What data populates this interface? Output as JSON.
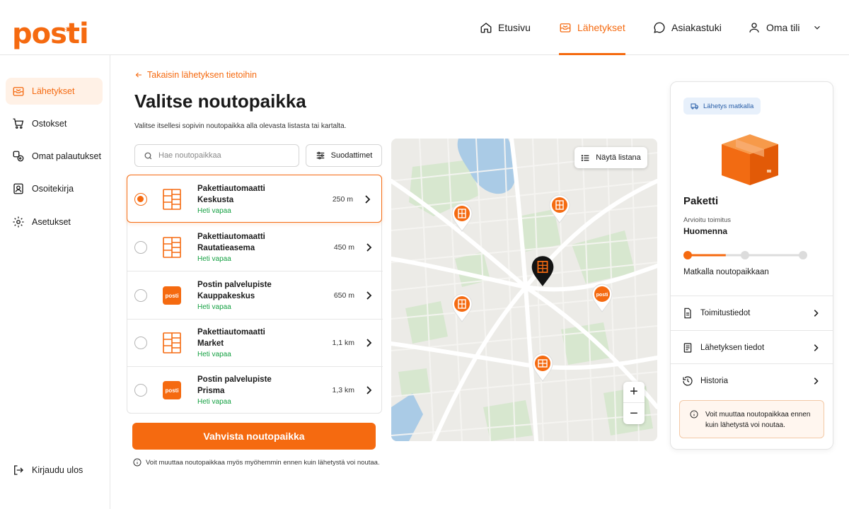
{
  "app": {
    "logo_text": "posti",
    "accent": "#f56a10"
  },
  "header": {
    "nav": [
      {
        "label": "Etusivu",
        "icon": "home-icon"
      },
      {
        "label": "Lähetykset",
        "icon": "package-inbox-icon",
        "active": true
      },
      {
        "label": "Asiakastuki",
        "icon": "chat-bubble-icon"
      },
      {
        "label": "Oma tili",
        "icon": "user-icon"
      }
    ]
  },
  "sidebar": {
    "items": [
      {
        "label": "Lähetykset",
        "icon": "package-inbox-icon",
        "active": true
      },
      {
        "label": "Ostokset",
        "icon": "cart-icon"
      },
      {
        "label": "Omat palautukset",
        "icon": "return-icon"
      },
      {
        "label": "Osoitekirja",
        "icon": "address-book-icon"
      },
      {
        "label": "Asetukset",
        "icon": "gear-icon"
      }
    ],
    "logout": "Kirjaudu ulos"
  },
  "main": {
    "back_link": "Takaisin lähetyksen tietoihin",
    "title": "Valitse noutopaikka",
    "description": "Valitse itsellesi sopivin noutopaikka alla olevasta listasta tai kartalta.",
    "search_placeholder": "Hae noutopaikkaa",
    "filters_label": "Suodattimet",
    "locations": [
      {
        "line1": "Pakettiautomaatti",
        "line2": "Keskusta",
        "status": "Heti vapaa",
        "distance": "250 m",
        "type": "locker",
        "selected": true
      },
      {
        "line1": "Pakettiautomaatti",
        "line2": "Rautatieasema",
        "status": "Heti vapaa",
        "distance": "450 m",
        "type": "locker",
        "selected": false
      },
      {
        "line1": "Postin palvelupiste",
        "line2": "Kauppakeskus",
        "status": "Heti vapaa",
        "distance": "650 m",
        "type": "posti",
        "selected": false
      },
      {
        "line1": "Pakettiautomaatti",
        "line2": "Market",
        "status": "Heti vapaa",
        "distance": "1,1 km",
        "type": "locker",
        "selected": false
      },
      {
        "line1": "Postin palvelupiste",
        "line2": "Prisma",
        "status": "Heti vapaa",
        "distance": "1,3 km",
        "type": "posti",
        "selected": false
      }
    ],
    "posti_badge_text": "posti",
    "confirm_label": "Vahvista noutopaikka",
    "note": "Voit muuttaa noutopaikkaa myös myöhemmin ennen kuin lähetystä voi noutaa."
  },
  "map": {
    "show_list_label": "Näytä listana",
    "zoom_in": "+",
    "zoom_out": "−",
    "pin_posti_text": "posti"
  },
  "shipment": {
    "badge": "Lähetys matkalla",
    "type": "Paketti",
    "estimate_label": "Arvioitu toimitus",
    "estimate_value": "Huomenna",
    "progress_fraction": 0.33,
    "progress_label": "Matkalla noutopaikkaan",
    "links": [
      {
        "label": "Toimitustiedot",
        "icon": "document-icon"
      },
      {
        "label": "Lähetyksen tiedot",
        "icon": "list-document-icon"
      },
      {
        "label": "Historia",
        "icon": "history-icon"
      }
    ],
    "notice": "Voit muuttaa noutopaikkaa ennen kuin lähetystä voi noutaa."
  }
}
